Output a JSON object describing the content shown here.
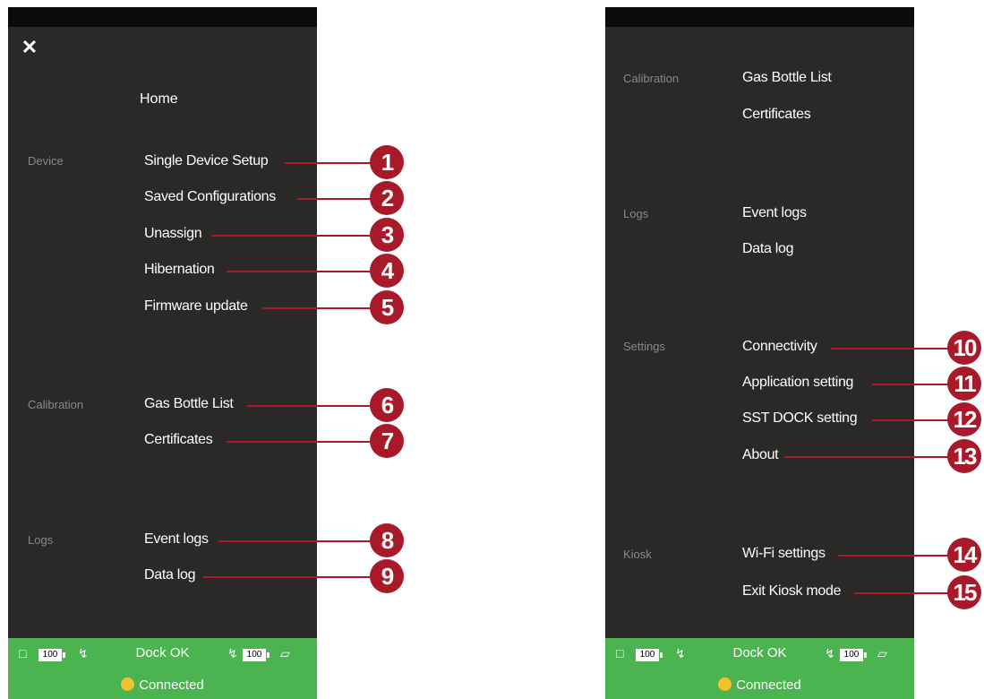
{
  "left_screen": {
    "close_label": "✕",
    "home": "Home",
    "sections": {
      "device": "Device",
      "calibration": "Calibration",
      "logs": "Logs"
    },
    "items": {
      "single_device_setup": "Single Device Setup",
      "saved_configurations": "Saved Configurations",
      "unassign": "Unassign",
      "hibernation": "Hibernation",
      "firmware_update": "Firmware update",
      "gas_bottle_list": "Gas Bottle List",
      "certificates": "Certificates",
      "event_logs": "Event logs",
      "data_log": "Data log"
    },
    "status": {
      "left_battery": "100",
      "right_battery": "100",
      "dock": "Dock OK",
      "connection": "Connected"
    }
  },
  "right_screen": {
    "sections": {
      "calibration": "Calibration",
      "logs": "Logs",
      "settings": "Settings",
      "kiosk": "Kiosk"
    },
    "items": {
      "gas_bottle_list": "Gas Bottle List",
      "certificates": "Certificates",
      "event_logs": "Event logs",
      "data_log": "Data log",
      "connectivity": "Connectivity",
      "application_setting": "Application setting",
      "sst_dock_setting": "SST DOCK setting",
      "about": "About",
      "wifi_settings": "Wi-Fi settings",
      "exit_kiosk_mode": "Exit Kiosk mode"
    },
    "status": {
      "left_battery": "100",
      "right_battery": "100",
      "dock": "Dock OK",
      "connection": "Connected"
    }
  },
  "annotations": [
    "1",
    "2",
    "3",
    "4",
    "5",
    "6",
    "7",
    "8",
    "9",
    "10",
    "11",
    "12",
    "13",
    "14",
    "15"
  ],
  "colors": {
    "background": "#2b2927",
    "status_bar": "#4bb34f",
    "annotation": "#a8192a"
  }
}
